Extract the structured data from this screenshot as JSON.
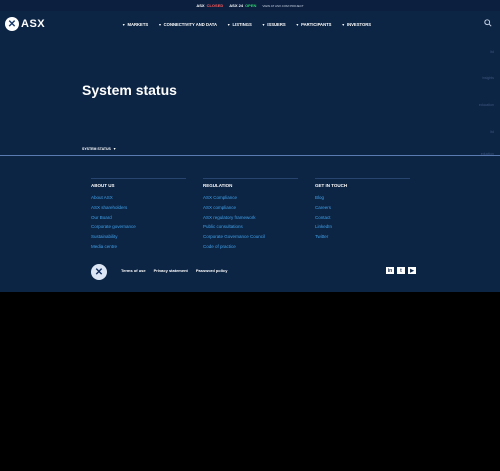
{
  "topstrip": {
    "asx_label": "ASX",
    "asx_status": "CLOSED",
    "asx24_label": "ASX 24",
    "asx24_status": "OPEN",
    "note": "VIEW AT ASX.COM PROJECT"
  },
  "header": {
    "logo_text": "ASX",
    "logo_mark": "✕",
    "nav": [
      "MARKETS",
      "CONNECTIVITY AND DATA",
      "LISTINGS",
      "ISSUERS",
      "PARTICIPANTS",
      "INVESTORS"
    ],
    "search_icon": "search-icon"
  },
  "main": {
    "title": "System status",
    "system_status_label": "SYSTEM STATUS",
    "side_ghost": [
      "ltd",
      "insights",
      "education",
      "ltd",
      "eduction"
    ]
  },
  "footer": {
    "columns": [
      {
        "heading": "ABOUT US",
        "links": [
          "About ASX",
          "ASX shareholders",
          "Our Board",
          "Corporate governance",
          "Sustainability",
          "Media centre"
        ]
      },
      {
        "heading": "REGULATION",
        "links": [
          "ASX Compliance",
          "ASX compliance",
          "ASX regulatory framework",
          "Public consultations",
          "Corporate Governance Council",
          "Code of practice"
        ]
      },
      {
        "heading": "GET IN TOUCH",
        "links": [
          "Blog",
          "Careers",
          "Contact",
          "LinkedIn",
          "Twitter"
        ]
      }
    ],
    "legal": [
      "Terms of use",
      "Privacy statement",
      "Password policy"
    ],
    "logo_mark": "✕",
    "social_icons": [
      "linkedin-icon",
      "twitter-icon",
      "youtube-icon"
    ],
    "social_glyphs": [
      "in",
      "t",
      "▶"
    ]
  },
  "colors": {
    "navy": "#0d2545",
    "link": "#3fa1ea",
    "closed": "#ff5a5a",
    "open": "#2fd66d"
  }
}
